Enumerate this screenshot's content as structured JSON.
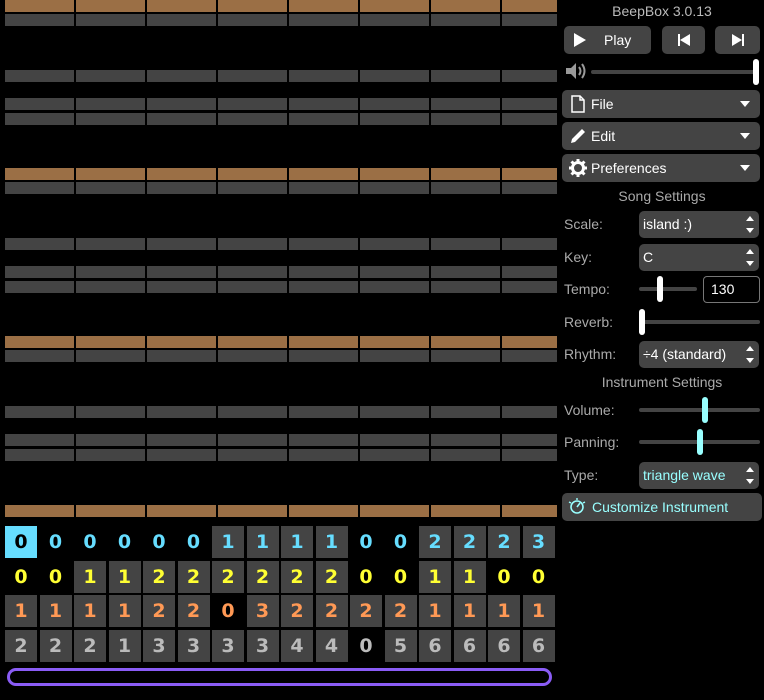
{
  "app": {
    "title": "BeepBox 3.0.13"
  },
  "transport": {
    "play_label": "Play"
  },
  "menus": {
    "file": "File",
    "edit": "Edit",
    "preferences": "Preferences"
  },
  "song_settings": {
    "heading": "Song Settings",
    "scale_label": "Scale:",
    "scale_value": "island :)",
    "key_label": "Key:",
    "key_value": "C",
    "tempo_label": "Tempo:",
    "tempo_value": "130",
    "reverb_label": "Reverb:",
    "rhythm_label": "Rhythm:",
    "rhythm_value": "÷4 (standard)",
    "volume_level": 1.0,
    "tempo_slider_level": 0.35,
    "reverb_level": 0.0
  },
  "instrument_settings": {
    "heading": "Instrument Settings",
    "volume_label": "Volume:",
    "volume_level": 0.55,
    "panning_label": "Panning:",
    "panning_level": 0.5,
    "type_label": "Type:",
    "type_value": "triangle wave",
    "customize_label": "Customize Instrument"
  },
  "pattern_grid": {
    "channel_colors": [
      "#66ddff",
      "#ffff33",
      "#ff9955",
      "#bbbbbb"
    ],
    "rows": [
      [
        "0",
        "0",
        "0",
        "0",
        "0",
        "0",
        "1",
        "1",
        "1",
        "1",
        "0",
        "0",
        "2",
        "2",
        "2",
        "3"
      ],
      [
        "0",
        "0",
        "1",
        "1",
        "2",
        "2",
        "2",
        "2",
        "2",
        "2",
        "0",
        "0",
        "1",
        "1",
        "0",
        "0"
      ],
      [
        "1",
        "1",
        "1",
        "1",
        "2",
        "2",
        "0",
        "3",
        "2",
        "2",
        "2",
        "2",
        "1",
        "1",
        "1",
        "1"
      ],
      [
        "2",
        "2",
        "2",
        "1",
        "3",
        "3",
        "3",
        "3",
        "4",
        "4",
        "0",
        "5",
        "6",
        "6",
        "6",
        "6"
      ]
    ],
    "selected": {
      "row": 0,
      "col": 0
    }
  },
  "colors": {
    "brown_line": "#9b6f45",
    "gray_line": "#444444",
    "scrollbar": "#8a5cf5",
    "accent_cyan": "#99ffff"
  }
}
